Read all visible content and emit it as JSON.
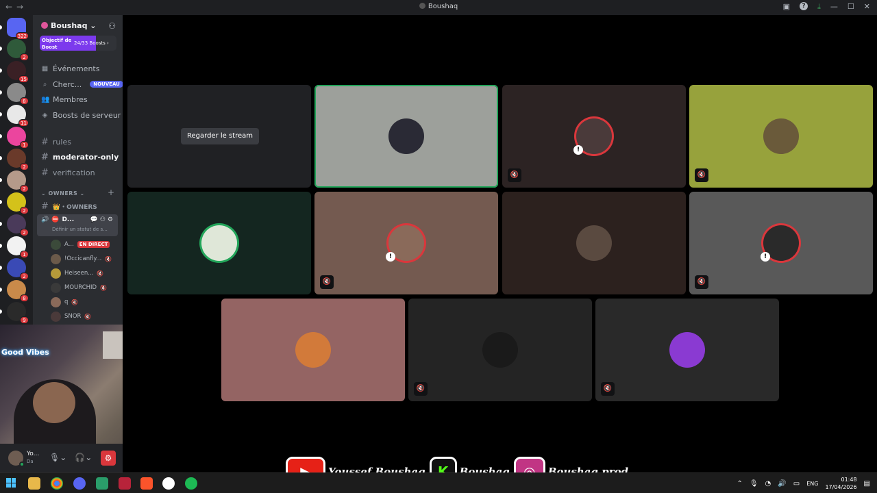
{
  "window": {
    "title": "Boushaq"
  },
  "server": {
    "name": "Boushaq",
    "boost_label": "Objectif de Boost",
    "boost_count": "24/33 Boosts",
    "boost_progress": 0.73,
    "menu": [
      {
        "label": "Événements",
        "icon": "calendar-icon"
      },
      {
        "label": "Cherc...",
        "icon": "search-icon",
        "badge": "NOUVEAU"
      },
      {
        "label": "Membres",
        "icon": "members-icon"
      },
      {
        "label": "Boosts de serveur",
        "icon": "boost-icon"
      }
    ],
    "channels": [
      {
        "name": "rules",
        "active": false
      },
      {
        "name": "moderator-only",
        "active": true
      },
      {
        "name": "verification",
        "active": false
      }
    ],
    "category": "OWNERS",
    "category_channel": "👑・OWNERS",
    "voice_channel": {
      "name": "D...",
      "status": "Définir un statut de s..."
    },
    "voice_users": [
      {
        "name": "A...",
        "live": "EN DIRECT",
        "color": "#3b4a3a"
      },
      {
        "name": "!Occicanfly...",
        "live": "",
        "color": "#6b5a4a"
      },
      {
        "name": "Heiseen...",
        "live": "",
        "color": "#b59a3a"
      },
      {
        "name": "MOURCHID",
        "live": "",
        "color": "#3a3a3a"
      },
      {
        "name": "q",
        "live": "",
        "color": "#8a6a5a"
      },
      {
        "name": "SNOR",
        "live": "",
        "color": "#4a3a3a"
      }
    ]
  },
  "guilds": [
    {
      "badge": "322",
      "color": "#5865f2"
    },
    {
      "badge": "2",
      "color": "#2f5a3a"
    },
    {
      "badge": "15",
      "color": "#3a2025"
    },
    {
      "badge": "8",
      "color": "#8a8a8a"
    },
    {
      "badge": "11",
      "color": "#e8e8e8"
    },
    {
      "badge": "1",
      "color": "#eb459e"
    },
    {
      "badge": "2",
      "color": "#6a3a2a"
    },
    {
      "badge": "2",
      "color": "#b59a8a"
    },
    {
      "badge": "2",
      "color": "#d4c21a"
    },
    {
      "badge": "2",
      "color": "#4a3a5a"
    },
    {
      "badge": "1",
      "color": "#f2f2f2"
    },
    {
      "badge": "2",
      "color": "#3a4ab5"
    },
    {
      "badge": "8",
      "color": "#c98a4a"
    },
    {
      "badge": "9",
      "color": "#2a2a2a"
    }
  ],
  "user": {
    "name": "Yo...",
    "status": "Da"
  },
  "tiles": [
    {
      "bg": "#202124",
      "stream_label": "Regarder le stream",
      "avatar": "",
      "muted": false,
      "ring": "",
      "warn": false,
      "speaking": false
    },
    {
      "bg": "#9da09b",
      "avatar": "#2a2a35",
      "muted": false,
      "ring": "",
      "warn": false,
      "speaking": true
    },
    {
      "bg": "#2c2323",
      "avatar": "#4a3a3a",
      "muted": true,
      "ring": "red",
      "warn": true,
      "speaking": false
    },
    {
      "bg": "#97a23c",
      "avatar": "#6a5a3a",
      "muted": true,
      "ring": "",
      "warn": false,
      "speaking": false
    },
    {
      "bg": "#142620",
      "avatar": "#dfe7d8",
      "muted": false,
      "ring": "green",
      "warn": false,
      "speaking": false
    },
    {
      "bg": "#745a50",
      "avatar": "#8a6a5a",
      "muted": true,
      "ring": "red",
      "warn": true,
      "speaking": false
    },
    {
      "bg": "#2c211e",
      "avatar": "#5a4a40",
      "muted": false,
      "ring": "",
      "warn": false,
      "speaking": false
    },
    {
      "bg": "#595959",
      "avatar": "#2a2a2a",
      "muted": true,
      "ring": "red",
      "warn": true,
      "speaking": false
    },
    {
      "bg": "#946463",
      "avatar": "#d27a3a",
      "muted": false,
      "ring": "",
      "warn": false,
      "speaking": false
    },
    {
      "bg": "#242424",
      "avatar": "#1a1a1a",
      "muted": true,
      "ring": "",
      "warn": false,
      "speaking": false
    },
    {
      "bg": "#292929",
      "avatar": "#8a3ad2",
      "muted": true,
      "ring": "",
      "warn": false,
      "speaking": false
    }
  ],
  "social": [
    {
      "platform": "youtube-icon",
      "color": "#e62117",
      "glyph": "▶",
      "handle": "Youssef Boushaq"
    },
    {
      "platform": "kick-icon",
      "color": "#111",
      "glyph": "K",
      "handle": "Boushaq"
    },
    {
      "platform": "instagram-icon",
      "color": "#c13584",
      "glyph": "◎",
      "handle": "Boushaq.prod"
    }
  ],
  "webcam": {
    "sign": "Good Vibes"
  },
  "tray": {
    "lang": "ENG",
    "time": "01:48",
    "date": "17/04/2026"
  }
}
